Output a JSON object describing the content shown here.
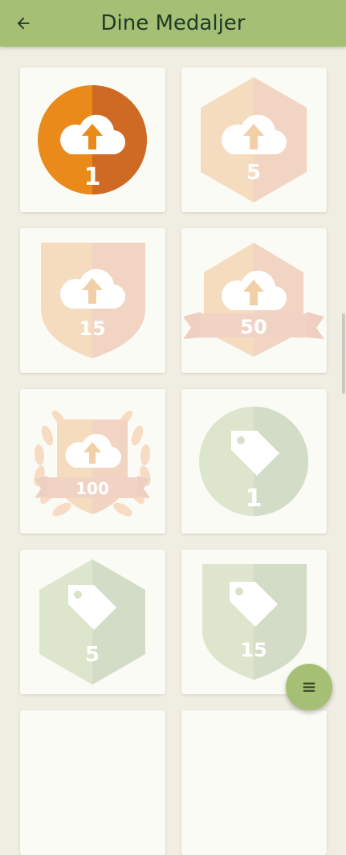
{
  "header": {
    "title": "Dine Medaljer",
    "back_icon": "arrow-left-icon"
  },
  "colors": {
    "appbar": "#a5bf75",
    "background": "#f0eee2",
    "upload_earned": "#e98a1a",
    "upload_locked": "#f5d6b0",
    "tag_locked": "#d9e3c7"
  },
  "medals": [
    {
      "label": "1",
      "shape": "circle",
      "icon": "cloud-upload-icon",
      "earned": true
    },
    {
      "label": "5",
      "shape": "hexagon",
      "icon": "cloud-upload-icon",
      "earned": false
    },
    {
      "label": "15",
      "shape": "shield",
      "icon": "cloud-upload-icon",
      "earned": false
    },
    {
      "label": "50",
      "shape": "ribbon",
      "icon": "cloud-upload-icon",
      "earned": false
    },
    {
      "label": "100",
      "shape": "laurel",
      "icon": "cloud-upload-icon",
      "earned": false
    },
    {
      "label": "1",
      "shape": "circle",
      "icon": "tag-icon",
      "earned": false
    },
    {
      "label": "5",
      "shape": "hexagon",
      "icon": "tag-icon",
      "earned": false
    },
    {
      "label": "15",
      "shape": "shield",
      "icon": "tag-icon",
      "earned": false
    }
  ],
  "fab": {
    "icon": "menu-icon"
  }
}
